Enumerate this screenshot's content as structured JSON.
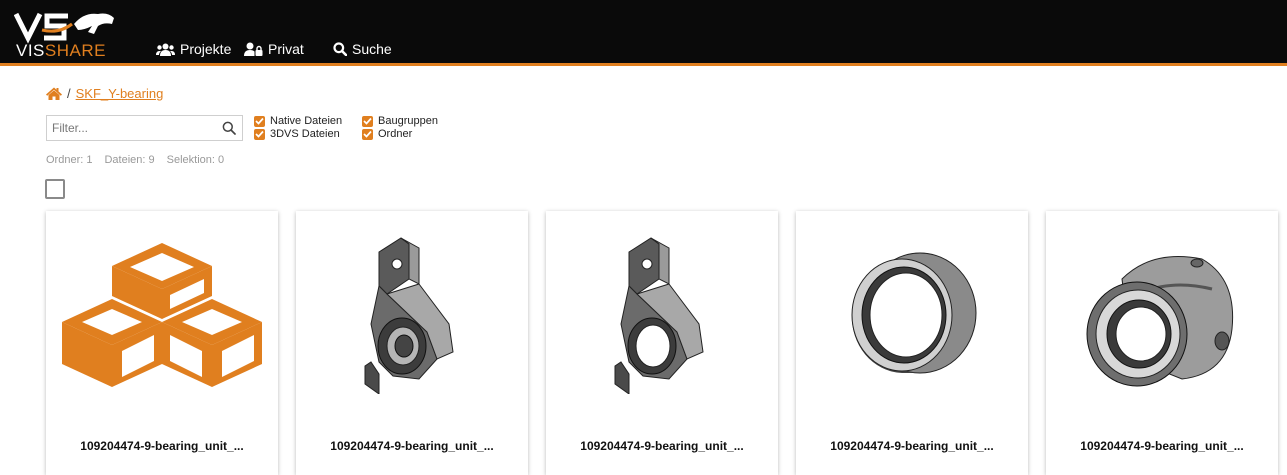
{
  "logo": {
    "mark": "VS",
    "text_part1": "VIS",
    "text_part2": "SHARE"
  },
  "nav": [
    {
      "label": "Projekte",
      "icon": "users-icon"
    },
    {
      "label": "Privat",
      "icon": "user-lock-icon"
    },
    {
      "label": "Suche",
      "icon": "search-icon"
    }
  ],
  "breadcrumb": {
    "separator": "/",
    "folder": "SKF_Y-bearing"
  },
  "filter": {
    "placeholder": "Filter...",
    "value": ""
  },
  "checkboxes": [
    {
      "label": "Native Dateien",
      "checked": true
    },
    {
      "label": "3DVS Dateien",
      "checked": true
    },
    {
      "label": "Baugruppen",
      "checked": true
    },
    {
      "label": "Ordner",
      "checked": true
    }
  ],
  "stats": {
    "folders": "Ordner: 1",
    "files": "Dateien: 9",
    "selection": "Selektion: 0"
  },
  "cards": [
    {
      "label": "109204474-9-bearing_unit_...",
      "thumb": "assembly-icon"
    },
    {
      "label": "109204474-9-bearing_unit_...",
      "thumb": "bearing-housing-thumbnail"
    },
    {
      "label": "109204474-9-bearing_unit_...",
      "thumb": "bearing-housing-thumbnail"
    },
    {
      "label": "109204474-9-bearing_unit_...",
      "thumb": "bearing-ring-thumbnail"
    },
    {
      "label": "109204474-9-bearing_unit_...",
      "thumb": "bearing-insert-thumbnail"
    }
  ],
  "colors": {
    "accent": "#e07f1f",
    "navbar": "#0a0a0a"
  }
}
